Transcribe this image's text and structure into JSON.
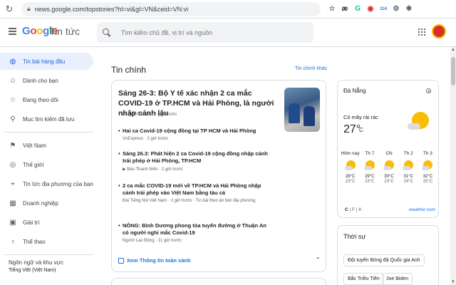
{
  "browser": {
    "url": "news.google.com/topstories?hl=vi&gl=VN&ceid=VN:vi",
    "extensions": [
      {
        "name": "star-icon",
        "glyph": "☆",
        "color": "#5f6368"
      },
      {
        "name": "ae-extension-icon",
        "glyph": "æ",
        "color": "#202124"
      },
      {
        "name": "grammarly-extension-icon",
        "glyph": "G",
        "color": "#15c39a"
      },
      {
        "name": "shield-extension-icon",
        "glyph": "◉",
        "color": "#d93025"
      },
      {
        "name": "badge-extension-icon",
        "glyph": "114",
        "color": "#1a73e8"
      },
      {
        "name": "gear-extension-icon",
        "glyph": "⚙",
        "color": "#5f6368"
      },
      {
        "name": "puzzle-icon",
        "glyph": "✱",
        "color": "#5f6368"
      }
    ]
  },
  "header": {
    "logo_google": "Google",
    "logo_app": "Tin tức",
    "search_placeholder": "Tìm kiếm chủ đề, vị trí và nguồn",
    "colors": {
      "g_blue": "#4285f4",
      "g_red": "#ea4335",
      "g_yellow": "#fbbc05",
      "g_green": "#34a853"
    }
  },
  "sidebar": {
    "items": [
      {
        "label": "Tin bài hàng đầu",
        "icon": "globe-icon",
        "active": true
      },
      {
        "label": "Dành cho bạn",
        "icon": "person-icon",
        "active": false
      },
      {
        "label": "Đang theo dõi",
        "icon": "star-icon",
        "active": false
      },
      {
        "label": "Mục tìm kiếm đã lưu",
        "icon": "search-icon",
        "active": false
      }
    ],
    "sections": [
      {
        "label": "Việt Nam",
        "icon": "flag-icon"
      },
      {
        "label": "Thế giới",
        "icon": "world-icon"
      },
      {
        "label": "Tin tức địa phương của bạn",
        "icon": "location-icon"
      },
      {
        "label": "Doanh nghiệp",
        "icon": "building-icon"
      },
      {
        "label": "Giải trí",
        "icon": "film-icon"
      },
      {
        "label": "Thể thao",
        "icon": "bike-icon"
      }
    ],
    "language_label": "Ngôn ngữ và khu vực",
    "language_value": "Tiếng Việt (Việt Nam)"
  },
  "main": {
    "section_title": "Tin chính",
    "more_link": "Tin chính khác",
    "top_story": {
      "headline": "Sáng 26-3: Bộ Y tế xác nhận 2 ca mắc COVID-19 ở TP.HCM và Hải Phòng, là người nhập cảnh lậu",
      "meta": "Tuổi Trẻ Online  ·  2 giờ trước",
      "related": [
        {
          "title": "Hai ca Covid-19 cộng đồng tại TP HCM và Hải Phòng",
          "meta": "VnExpress  ·  2 giờ trước"
        },
        {
          "title": "Sáng 26.3: Phát hiện 2 ca Covid-19 cộng đồng nhập cảnh trái phép ở Hải Phòng, TP.HCM",
          "meta": "▶ Báo Thanh Niên  ·  2 giờ trước"
        },
        {
          "title": "2 ca mắc COVID-19 mới về TP.HCM và Hải Phòng nhập cảnh trái phép vào Việt Nam bằng tàu cá",
          "meta": "Đài Tiếng Nói Việt Nam  ·  2 giờ trước  ·  Tin bài theo ản bản địa phương"
        },
        {
          "title": "NÓNG: Bình Dương phong tỏa tuyến đường ở Thuận An có người nghi mắc Covid-19",
          "meta": "Người Lao Động  ·  11 giờ trước"
        }
      ],
      "full_coverage": "Xem Thông tin toàn cảnh"
    }
  },
  "weather": {
    "city": "Đà Nẵng",
    "condition": "Có mây rải rác",
    "temp": "27°",
    "unit": "C",
    "forecast": [
      {
        "day": "Hôm nay",
        "hi": "28°C",
        "lo": "23°C"
      },
      {
        "day": "Th 7",
        "hi": "29°C",
        "lo": "23°C"
      },
      {
        "day": "CN",
        "hi": "30°C",
        "lo": "23°C"
      },
      {
        "day": "Th 2",
        "hi": "31°C",
        "lo": "24°C"
      },
      {
        "day": "Th 3",
        "hi": "32°C",
        "lo": "25°C"
      }
    ],
    "unit_c": "C",
    "unit_f": "F",
    "unit_k": "K",
    "source": "weather.com"
  },
  "topics": {
    "title": "Thời sự",
    "chips": [
      "Đội tuyển Bóng đá Quốc gia Anh",
      "Bắc Triều Tiên",
      "Joe Biden"
    ]
  }
}
